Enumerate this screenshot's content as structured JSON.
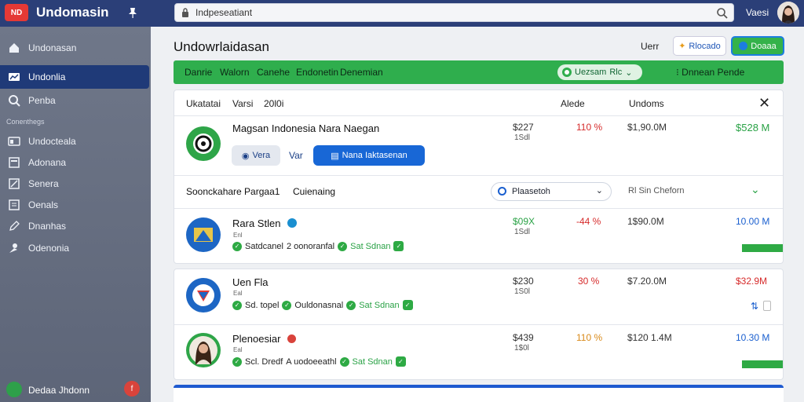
{
  "app": {
    "logo": "ND",
    "title": "Undomasin",
    "user": "Vaesi"
  },
  "search": {
    "value": "Indpeseatiant"
  },
  "sidebar": {
    "items": [
      {
        "label": "Undonasan",
        "icon": "home-icon"
      },
      {
        "label": "Undonlia",
        "icon": "chart-icon",
        "active": true
      },
      {
        "label": "Penba",
        "icon": "search-icon"
      }
    ],
    "section": "Conenthegs",
    "items2": [
      {
        "label": "Undocteala",
        "icon": "dashboard-icon"
      },
      {
        "label": "Adonana",
        "icon": "document-icon"
      },
      {
        "label": "Senera",
        "icon": "edit-icon"
      },
      {
        "label": "Oenals",
        "icon": "list-icon"
      },
      {
        "label": "Dnanhas",
        "icon": "pen-icon"
      },
      {
        "label": "Odenonia",
        "icon": "user-icon"
      }
    ],
    "bottom": {
      "label": "Dedaa Jhdonn",
      "badge": "f"
    }
  },
  "header": {
    "title": "Undowrlaidasan",
    "label": "Uerr",
    "btn1": "Rlocado",
    "btn2": "Doaaa"
  },
  "tabs": [
    "Danrie",
    "Walorn",
    "Canehe",
    "Endonetin",
    "Denemian"
  ],
  "tab_pill": {
    "label": "Uezsam",
    "sub": "Rlc"
  },
  "tab_right": "Dnnean Pende",
  "table": {
    "headers": {
      "c1": "Ukatatai",
      "c2": "Varsi",
      "c3": "20l0i",
      "c4": "Alede",
      "c5": "Undoms"
    },
    "row1": {
      "name": "Magsan Indonesia Nara Naegan",
      "v1": "$227",
      "v1sub": "1Sdl",
      "v2": "110 %",
      "v3": "$1,90.0M",
      "v4": "$528 M",
      "btn_a": "Vera",
      "btn_b": "Var",
      "btn_c": "Nana Iaktasenan"
    },
    "filter": {
      "l1": "Soonckahare Pargaa1",
      "l2": "Cuienaing",
      "select": "Plaasetoh",
      "right": "Rl Sin Cheforn"
    },
    "rows": [
      {
        "name": "Rara Stlen",
        "sub": "Enl",
        "c1": "Satdcanel",
        "c2": "2 oonoranfal",
        "c3": "Sat Sdnan",
        "v1": "$09X",
        "v1sub": "1Sdl",
        "v2": "-44 %",
        "v3": "1$90.0M",
        "v4": "10.00 M"
      },
      {
        "name": "Uen Fla",
        "sub": "Eal",
        "c1": "Sd. topel",
        "c2": "Ouldonasnal",
        "c3": "Sat Sdnan",
        "v1": "$230",
        "v1sub": "1S0l",
        "v2": "30 %",
        "v3": "$7.20.0M",
        "v4": "$32.9M"
      },
      {
        "name": "Plenoesiar",
        "sub": "Eal",
        "c1": "Scl. Dredf",
        "c2": "A uodoeeathl",
        "c3": "Sat Sdnan",
        "v1": "$439",
        "v1sub": "1$0l",
        "v2": "110 %",
        "v3": "$120 1.4M",
        "v4": "10.30 M"
      }
    ]
  },
  "colors": {
    "topbar": "#2b3f78",
    "sidebar": "#6f7789",
    "accent_green": "#2fae4d",
    "accent_blue": "#1a5fcf",
    "red": "#d62b2b"
  }
}
